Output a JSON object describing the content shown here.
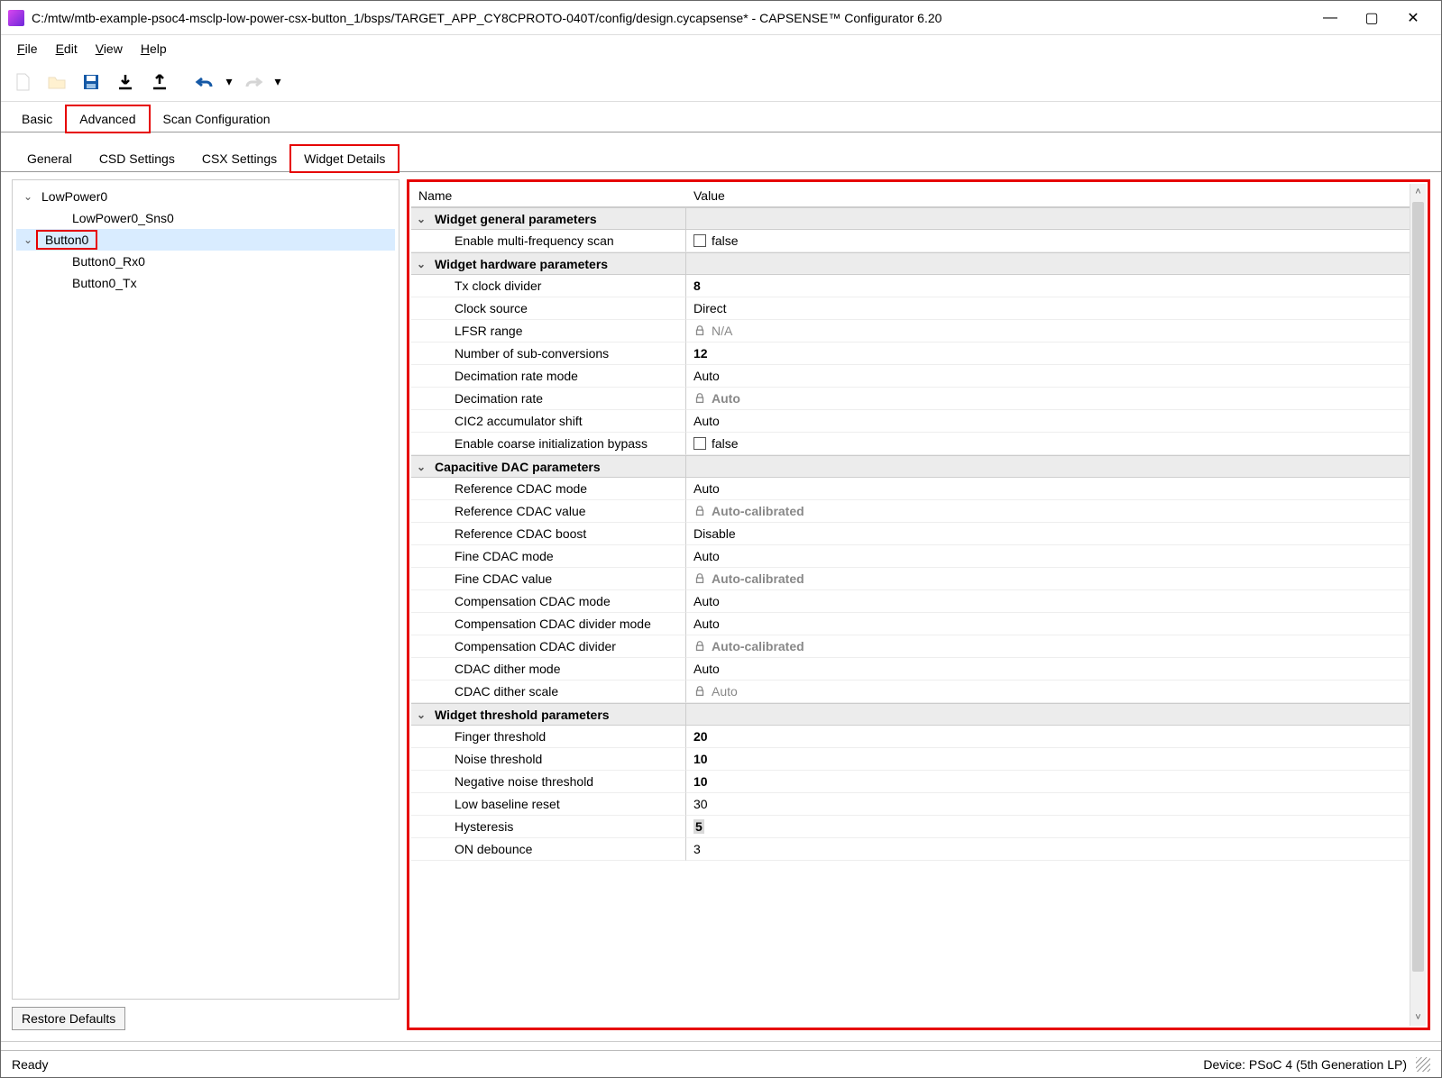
{
  "window": {
    "title": "C:/mtw/mtb-example-psoc4-msclp-low-power-csx-button_1/bsps/TARGET_APP_CY8CPROTO-040T/config/design.cycapsense* - CAPSENSE™ Configurator 6.20"
  },
  "menu": {
    "file": "File",
    "edit": "Edit",
    "view": "View",
    "help": "Help"
  },
  "maintabs": {
    "basic": "Basic",
    "advanced": "Advanced",
    "scan": "Scan Configuration"
  },
  "subtabs": {
    "general": "General",
    "csd": "CSD Settings",
    "csx": "CSX Settings",
    "widget": "Widget Details"
  },
  "tree": {
    "lowpower": "LowPower0",
    "lp_sns": "LowPower0_Sns0",
    "button": "Button0",
    "btn_rx": "Button0_Rx0",
    "btn_tx": "Button0_Tx"
  },
  "buttons": {
    "restore": "Restore Defaults"
  },
  "grid": {
    "name_h": "Name",
    "value_h": "Value",
    "sec_general": "Widget general parameters",
    "p_multi": "Enable multi-frequency scan",
    "v_multi": "false",
    "sec_hw": "Widget hardware parameters",
    "p_tx": "Tx clock divider",
    "v_tx": "8",
    "p_clk": "Clock source",
    "v_clk": "Direct",
    "p_lfsr": "LFSR range",
    "v_lfsr": "N/A",
    "p_sub": "Number of sub-conversions",
    "v_sub": "12",
    "p_decmode": "Decimation rate mode",
    "v_decmode": "Auto",
    "p_decrate": "Decimation rate",
    "v_decrate": "Auto",
    "p_cic2": "CIC2 accumulator shift",
    "v_cic2": "Auto",
    "p_coarse": "Enable coarse initialization bypass",
    "v_coarse": "false",
    "sec_dac": "Capacitive DAC parameters",
    "p_ref_mode": "Reference CDAC mode",
    "v_ref_mode": "Auto",
    "p_ref_val": "Reference CDAC value",
    "v_ref_val": "Auto-calibrated",
    "p_ref_boost": "Reference CDAC boost",
    "v_ref_boost": "Disable",
    "p_fine_mode": "Fine CDAC mode",
    "v_fine_mode": "Auto",
    "p_fine_val": "Fine CDAC value",
    "v_fine_val": "Auto-calibrated",
    "p_comp_mode": "Compensation CDAC mode",
    "v_comp_mode": "Auto",
    "p_comp_div_mode": "Compensation CDAC divider mode",
    "v_comp_div_mode": "Auto",
    "p_comp_div": "Compensation CDAC divider",
    "v_comp_div": "Auto-calibrated",
    "p_dither_mode": "CDAC dither mode",
    "v_dither_mode": "Auto",
    "p_dither_scale": "CDAC dither scale",
    "v_dither_scale": "Auto",
    "sec_thr": "Widget threshold parameters",
    "p_finger": "Finger threshold",
    "v_finger": "20",
    "p_noise": "Noise threshold",
    "v_noise": "10",
    "p_neg": "Negative noise threshold",
    "v_neg": "10",
    "p_low": "Low baseline reset",
    "v_low": "30",
    "p_hys": "Hysteresis",
    "v_hys": "5",
    "p_on": "ON debounce",
    "v_on": "3"
  },
  "status": {
    "ready": "Ready",
    "device": "Device: PSoC 4 (5th Generation LP)"
  }
}
